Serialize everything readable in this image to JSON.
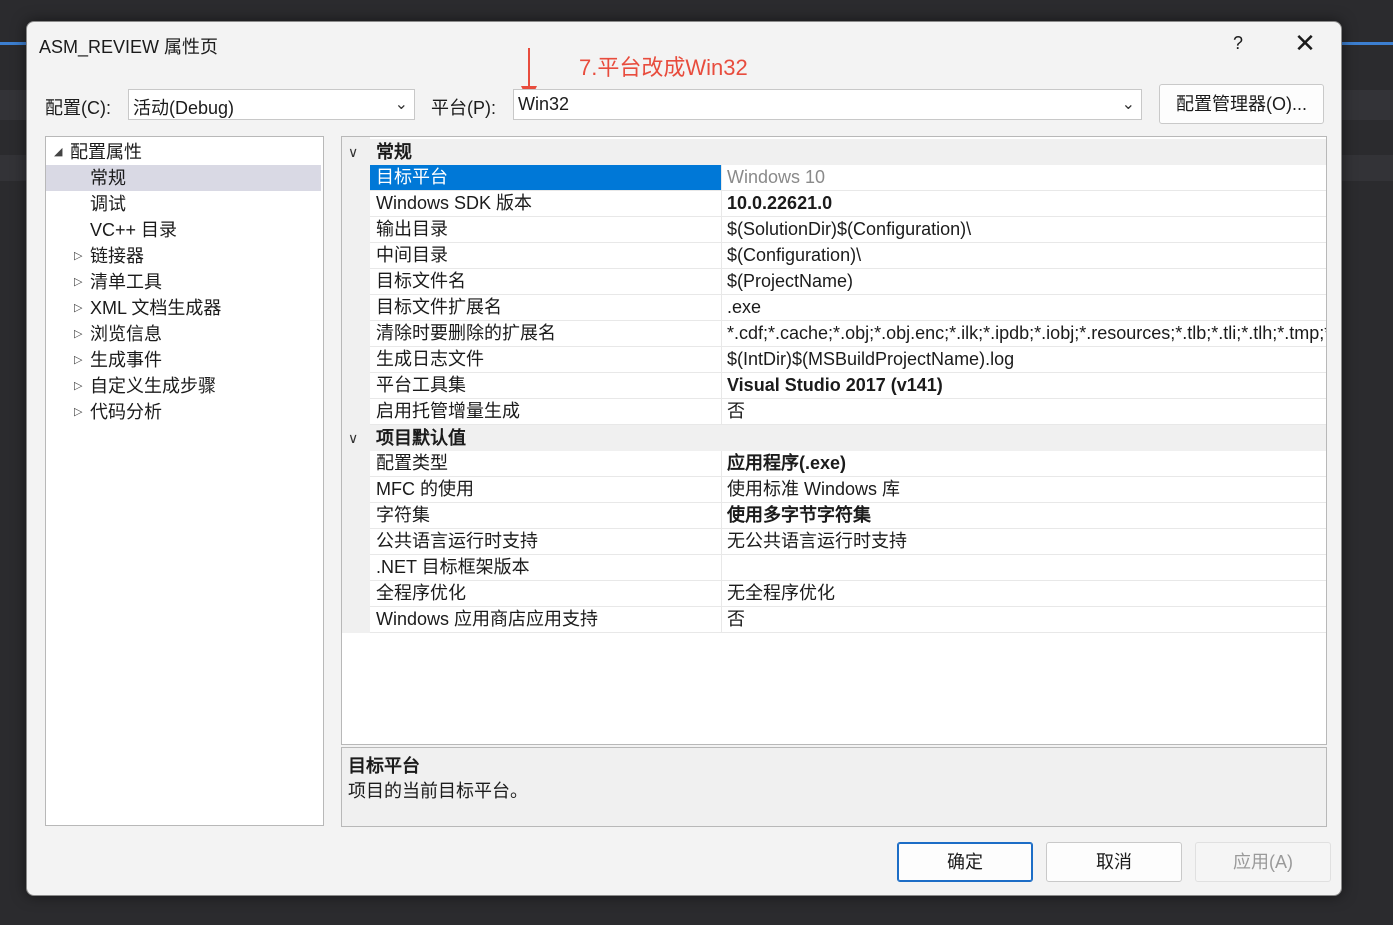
{
  "window": {
    "title": "ASM_REVIEW 属性页",
    "help": "?",
    "close": "✕"
  },
  "annotation": "7.平台改成Win32",
  "config": {
    "label": "配置(C):",
    "value": "活动(Debug)"
  },
  "platform": {
    "label": "平台(P):",
    "value": "Win32"
  },
  "config_manager_label": "配置管理器(O)...",
  "tree": {
    "root": "配置属性",
    "items": [
      {
        "label": "常规",
        "expandable": false,
        "selected": true
      },
      {
        "label": "调试",
        "expandable": false,
        "selected": false
      },
      {
        "label": "VC++ 目录",
        "expandable": false,
        "selected": false
      },
      {
        "label": "链接器",
        "expandable": true,
        "selected": false
      },
      {
        "label": "清单工具",
        "expandable": true,
        "selected": false
      },
      {
        "label": "XML 文档生成器",
        "expandable": true,
        "selected": false
      },
      {
        "label": "浏览信息",
        "expandable": true,
        "selected": false
      },
      {
        "label": "生成事件",
        "expandable": true,
        "selected": false
      },
      {
        "label": "自定义生成步骤",
        "expandable": true,
        "selected": false
      },
      {
        "label": "代码分析",
        "expandable": true,
        "selected": false
      }
    ]
  },
  "grid": {
    "sections": [
      {
        "title": "常规",
        "rows": [
          {
            "name": "目标平台",
            "value": "Windows 10",
            "style": "dim",
            "selected": true
          },
          {
            "name": "Windows SDK 版本",
            "value": "10.0.22621.0",
            "style": "bold"
          },
          {
            "name": "输出目录",
            "value": "$(SolutionDir)$(Configuration)\\",
            "style": ""
          },
          {
            "name": "中间目录",
            "value": "$(Configuration)\\",
            "style": ""
          },
          {
            "name": "目标文件名",
            "value": "$(ProjectName)",
            "style": ""
          },
          {
            "name": "目标文件扩展名",
            "value": ".exe",
            "style": ""
          },
          {
            "name": "清除时要删除的扩展名",
            "value": "*.cdf;*.cache;*.obj;*.obj.enc;*.ilk;*.ipdb;*.iobj;*.resources;*.tlb;*.tli;*.tlh;*.tmp;*.rsp;*.pgc;*.pgd;*.meta",
            "style": ""
          },
          {
            "name": "生成日志文件",
            "value": "$(IntDir)$(MSBuildProjectName).log",
            "style": ""
          },
          {
            "name": "平台工具集",
            "value": "Visual Studio 2017 (v141)",
            "style": "bold"
          },
          {
            "name": "启用托管增量生成",
            "value": "否",
            "style": ""
          }
        ]
      },
      {
        "title": "项目默认值",
        "rows": [
          {
            "name": "配置类型",
            "value": "应用程序(.exe)",
            "style": "bold"
          },
          {
            "name": "MFC 的使用",
            "value": "使用标准 Windows 库",
            "style": ""
          },
          {
            "name": "字符集",
            "value": "使用多字节字符集",
            "style": "bold"
          },
          {
            "name": "公共语言运行时支持",
            "value": "无公共语言运行时支持",
            "style": ""
          },
          {
            "name": ".NET 目标框架版本",
            "value": "",
            "style": ""
          },
          {
            "name": "全程序优化",
            "value": "无全程序优化",
            "style": ""
          },
          {
            "name": "Windows 应用商店应用支持",
            "value": "否",
            "style": ""
          }
        ]
      }
    ]
  },
  "description": {
    "title": "目标平台",
    "text": "项目的当前目标平台。"
  },
  "buttons": {
    "ok": "确定",
    "cancel": "取消",
    "apply": "应用(A)"
  },
  "colors": {
    "selection": "#0078d7",
    "annotation": "#e84c3d",
    "accent": "#1c6dc6"
  }
}
